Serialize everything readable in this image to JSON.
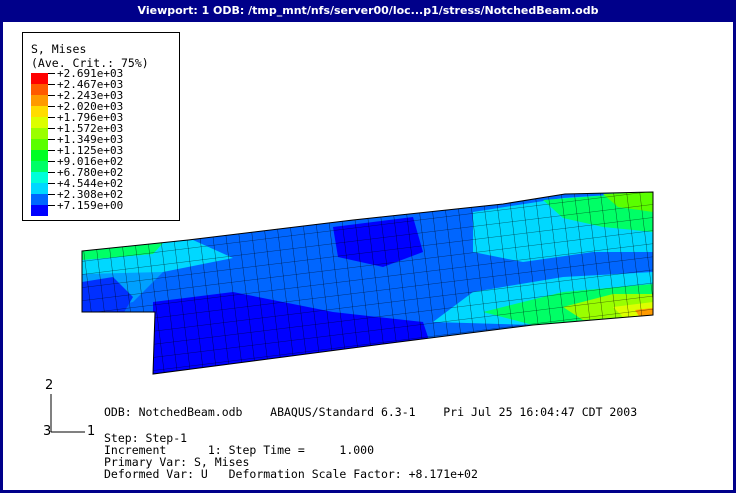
{
  "window": {
    "title": "Viewport: 1     ODB: /tmp_mnt/nfs/server00/loc...p1/stress/NotchedBeam.odb"
  },
  "legend": {
    "title": "S, Mises",
    "subtitle": "(Ave. Crit.: 75%)",
    "entries": [
      {
        "label": "+2.691e+03",
        "color": "#ff0000"
      },
      {
        "label": "+2.467e+03",
        "color": "#ff5a00"
      },
      {
        "label": "+2.243e+03",
        "color": "#ff9a00"
      },
      {
        "label": "+2.020e+03",
        "color": "#ffdc00"
      },
      {
        "label": "+1.796e+03",
        "color": "#dcff00"
      },
      {
        "label": "+1.572e+03",
        "color": "#9aff00"
      },
      {
        "label": "+1.349e+03",
        "color": "#5aff00"
      },
      {
        "label": "+1.125e+03",
        "color": "#00ff24"
      },
      {
        "label": "+9.016e+02",
        "color": "#00ff66"
      },
      {
        "label": "+6.780e+02",
        "color": "#00ffd8"
      },
      {
        "label": "+4.544e+02",
        "color": "#00d8ff"
      },
      {
        "label": "+2.308e+02",
        "color": "#0066ff"
      },
      {
        "label": "+7.159e+00",
        "color": "#0000ff"
      }
    ]
  },
  "triad": {
    "axis_2": "2",
    "axis_1": "1",
    "axis_3": "3"
  },
  "info": {
    "line1": "ODB: NotchedBeam.odb    ABAQUS/Standard 6.3-1    Pri Jul 25 16:04:47 CDT 2003",
    "line2": "Step: Step-1",
    "line3": "Increment      1: Step Time =     1.000",
    "line4": "Primary Var: S, Mises",
    "line5": "Deformed Var: U   Deformation Scale Factor: +8.171e+02"
  }
}
